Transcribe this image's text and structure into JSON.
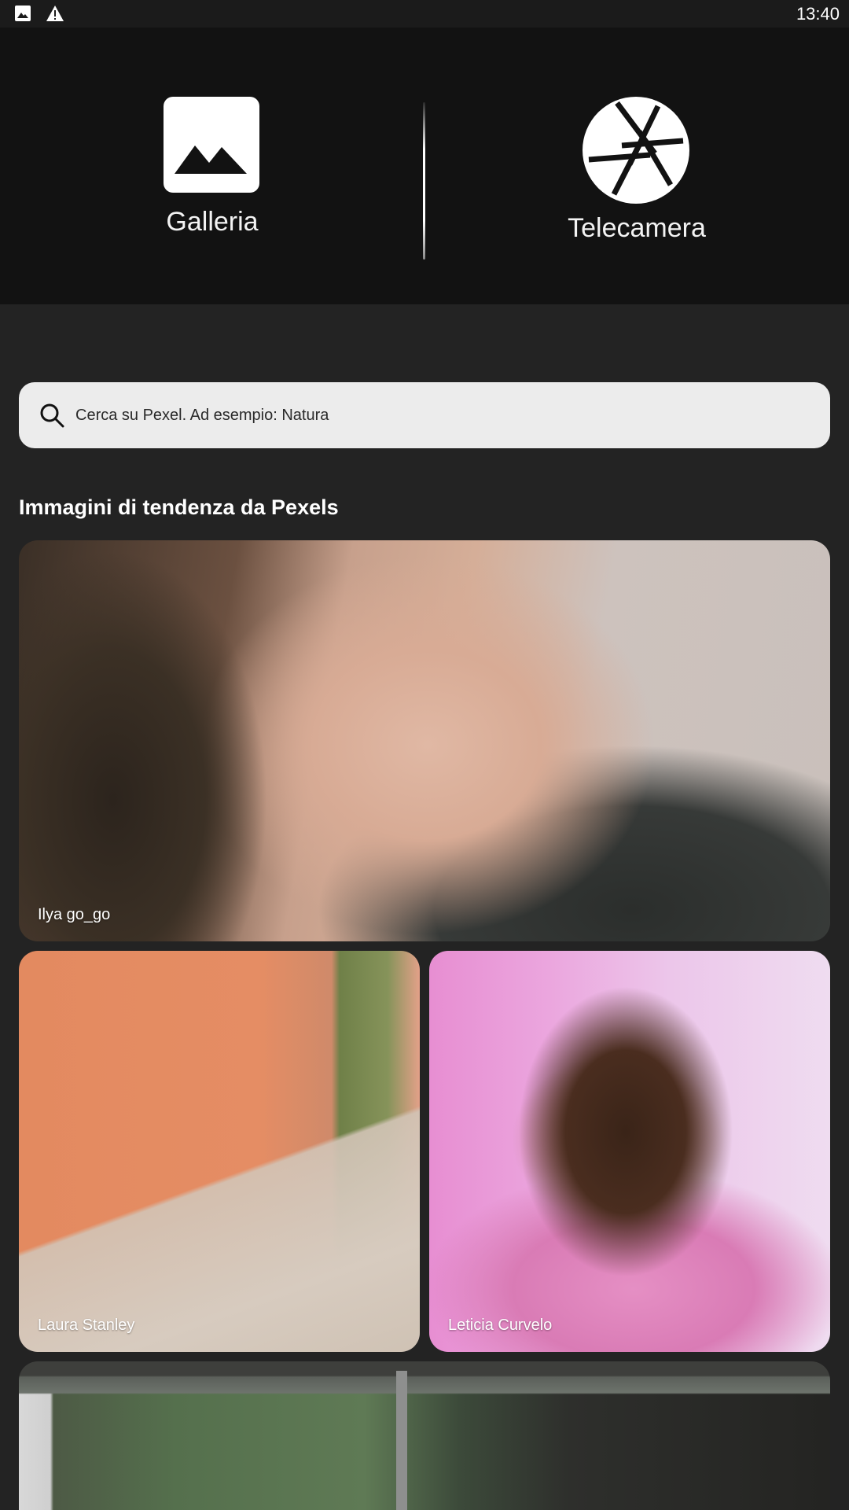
{
  "status_bar": {
    "time": "13:40",
    "icons": [
      "image-icon",
      "warning-icon"
    ]
  },
  "actions": {
    "gallery_label": "Galleria",
    "camera_label": "Telecamera"
  },
  "search": {
    "placeholder": "Cerca su Pexel. Ad esempio: Natura",
    "value": ""
  },
  "section": {
    "title": "Immagini di tendenza da Pexels"
  },
  "photos": [
    {
      "credit": "Ilya go_go"
    },
    {
      "credit": "Laura Stanley"
    },
    {
      "credit": "Leticia  Curvelo"
    },
    {
      "credit": ""
    }
  ],
  "colors": {
    "background": "#232323",
    "top_panel": "#121212",
    "search_bg": "#ececec"
  }
}
